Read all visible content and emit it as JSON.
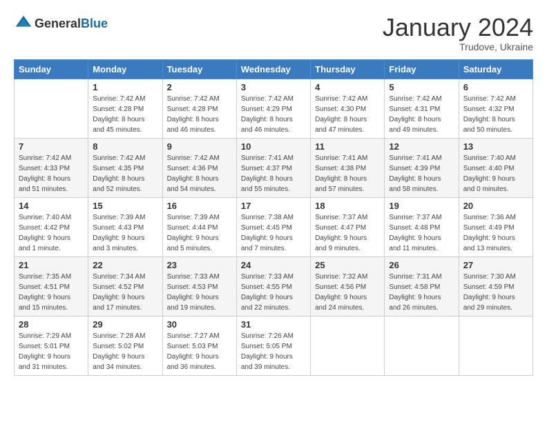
{
  "header": {
    "logo_general": "General",
    "logo_blue": "Blue",
    "month_year": "January 2024",
    "location": "Trudove, Ukraine"
  },
  "weekdays": [
    "Sunday",
    "Monday",
    "Tuesday",
    "Wednesday",
    "Thursday",
    "Friday",
    "Saturday"
  ],
  "weeks": [
    [
      {
        "day": "",
        "sunrise": "",
        "sunset": "",
        "daylight": ""
      },
      {
        "day": "1",
        "sunrise": "Sunrise: 7:42 AM",
        "sunset": "Sunset: 4:28 PM",
        "daylight": "Daylight: 8 hours and 45 minutes."
      },
      {
        "day": "2",
        "sunrise": "Sunrise: 7:42 AM",
        "sunset": "Sunset: 4:28 PM",
        "daylight": "Daylight: 8 hours and 46 minutes."
      },
      {
        "day": "3",
        "sunrise": "Sunrise: 7:42 AM",
        "sunset": "Sunset: 4:29 PM",
        "daylight": "Daylight: 8 hours and 46 minutes."
      },
      {
        "day": "4",
        "sunrise": "Sunrise: 7:42 AM",
        "sunset": "Sunset: 4:30 PM",
        "daylight": "Daylight: 8 hours and 47 minutes."
      },
      {
        "day": "5",
        "sunrise": "Sunrise: 7:42 AM",
        "sunset": "Sunset: 4:31 PM",
        "daylight": "Daylight: 8 hours and 49 minutes."
      },
      {
        "day": "6",
        "sunrise": "Sunrise: 7:42 AM",
        "sunset": "Sunset: 4:32 PM",
        "daylight": "Daylight: 8 hours and 50 minutes."
      }
    ],
    [
      {
        "day": "7",
        "sunrise": "Sunrise: 7:42 AM",
        "sunset": "Sunset: 4:33 PM",
        "daylight": "Daylight: 8 hours and 51 minutes."
      },
      {
        "day": "8",
        "sunrise": "Sunrise: 7:42 AM",
        "sunset": "Sunset: 4:35 PM",
        "daylight": "Daylight: 8 hours and 52 minutes."
      },
      {
        "day": "9",
        "sunrise": "Sunrise: 7:42 AM",
        "sunset": "Sunset: 4:36 PM",
        "daylight": "Daylight: 8 hours and 54 minutes."
      },
      {
        "day": "10",
        "sunrise": "Sunrise: 7:41 AM",
        "sunset": "Sunset: 4:37 PM",
        "daylight": "Daylight: 8 hours and 55 minutes."
      },
      {
        "day": "11",
        "sunrise": "Sunrise: 7:41 AM",
        "sunset": "Sunset: 4:38 PM",
        "daylight": "Daylight: 8 hours and 57 minutes."
      },
      {
        "day": "12",
        "sunrise": "Sunrise: 7:41 AM",
        "sunset": "Sunset: 4:39 PM",
        "daylight": "Daylight: 8 hours and 58 minutes."
      },
      {
        "day": "13",
        "sunrise": "Sunrise: 7:40 AM",
        "sunset": "Sunset: 4:40 PM",
        "daylight": "Daylight: 9 hours and 0 minutes."
      }
    ],
    [
      {
        "day": "14",
        "sunrise": "Sunrise: 7:40 AM",
        "sunset": "Sunset: 4:42 PM",
        "daylight": "Daylight: 9 hours and 1 minute."
      },
      {
        "day": "15",
        "sunrise": "Sunrise: 7:39 AM",
        "sunset": "Sunset: 4:43 PM",
        "daylight": "Daylight: 9 hours and 3 minutes."
      },
      {
        "day": "16",
        "sunrise": "Sunrise: 7:39 AM",
        "sunset": "Sunset: 4:44 PM",
        "daylight": "Daylight: 9 hours and 5 minutes."
      },
      {
        "day": "17",
        "sunrise": "Sunrise: 7:38 AM",
        "sunset": "Sunset: 4:45 PM",
        "daylight": "Daylight: 9 hours and 7 minutes."
      },
      {
        "day": "18",
        "sunrise": "Sunrise: 7:37 AM",
        "sunset": "Sunset: 4:47 PM",
        "daylight": "Daylight: 9 hours and 9 minutes."
      },
      {
        "day": "19",
        "sunrise": "Sunrise: 7:37 AM",
        "sunset": "Sunset: 4:48 PM",
        "daylight": "Daylight: 9 hours and 11 minutes."
      },
      {
        "day": "20",
        "sunrise": "Sunrise: 7:36 AM",
        "sunset": "Sunset: 4:49 PM",
        "daylight": "Daylight: 9 hours and 13 minutes."
      }
    ],
    [
      {
        "day": "21",
        "sunrise": "Sunrise: 7:35 AM",
        "sunset": "Sunset: 4:51 PM",
        "daylight": "Daylight: 9 hours and 15 minutes."
      },
      {
        "day": "22",
        "sunrise": "Sunrise: 7:34 AM",
        "sunset": "Sunset: 4:52 PM",
        "daylight": "Daylight: 9 hours and 17 minutes."
      },
      {
        "day": "23",
        "sunrise": "Sunrise: 7:33 AM",
        "sunset": "Sunset: 4:53 PM",
        "daylight": "Daylight: 9 hours and 19 minutes."
      },
      {
        "day": "24",
        "sunrise": "Sunrise: 7:33 AM",
        "sunset": "Sunset: 4:55 PM",
        "daylight": "Daylight: 9 hours and 22 minutes."
      },
      {
        "day": "25",
        "sunrise": "Sunrise: 7:32 AM",
        "sunset": "Sunset: 4:56 PM",
        "daylight": "Daylight: 9 hours and 24 minutes."
      },
      {
        "day": "26",
        "sunrise": "Sunrise: 7:31 AM",
        "sunset": "Sunset: 4:58 PM",
        "daylight": "Daylight: 9 hours and 26 minutes."
      },
      {
        "day": "27",
        "sunrise": "Sunrise: 7:30 AM",
        "sunset": "Sunset: 4:59 PM",
        "daylight": "Daylight: 9 hours and 29 minutes."
      }
    ],
    [
      {
        "day": "28",
        "sunrise": "Sunrise: 7:29 AM",
        "sunset": "Sunset: 5:01 PM",
        "daylight": "Daylight: 9 hours and 31 minutes."
      },
      {
        "day": "29",
        "sunrise": "Sunrise: 7:28 AM",
        "sunset": "Sunset: 5:02 PM",
        "daylight": "Daylight: 9 hours and 34 minutes."
      },
      {
        "day": "30",
        "sunrise": "Sunrise: 7:27 AM",
        "sunset": "Sunset: 5:03 PM",
        "daylight": "Daylight: 9 hours and 36 minutes."
      },
      {
        "day": "31",
        "sunrise": "Sunrise: 7:26 AM",
        "sunset": "Sunset: 5:05 PM",
        "daylight": "Daylight: 9 hours and 39 minutes."
      },
      {
        "day": "",
        "sunrise": "",
        "sunset": "",
        "daylight": ""
      },
      {
        "day": "",
        "sunrise": "",
        "sunset": "",
        "daylight": ""
      },
      {
        "day": "",
        "sunrise": "",
        "sunset": "",
        "daylight": ""
      }
    ]
  ]
}
